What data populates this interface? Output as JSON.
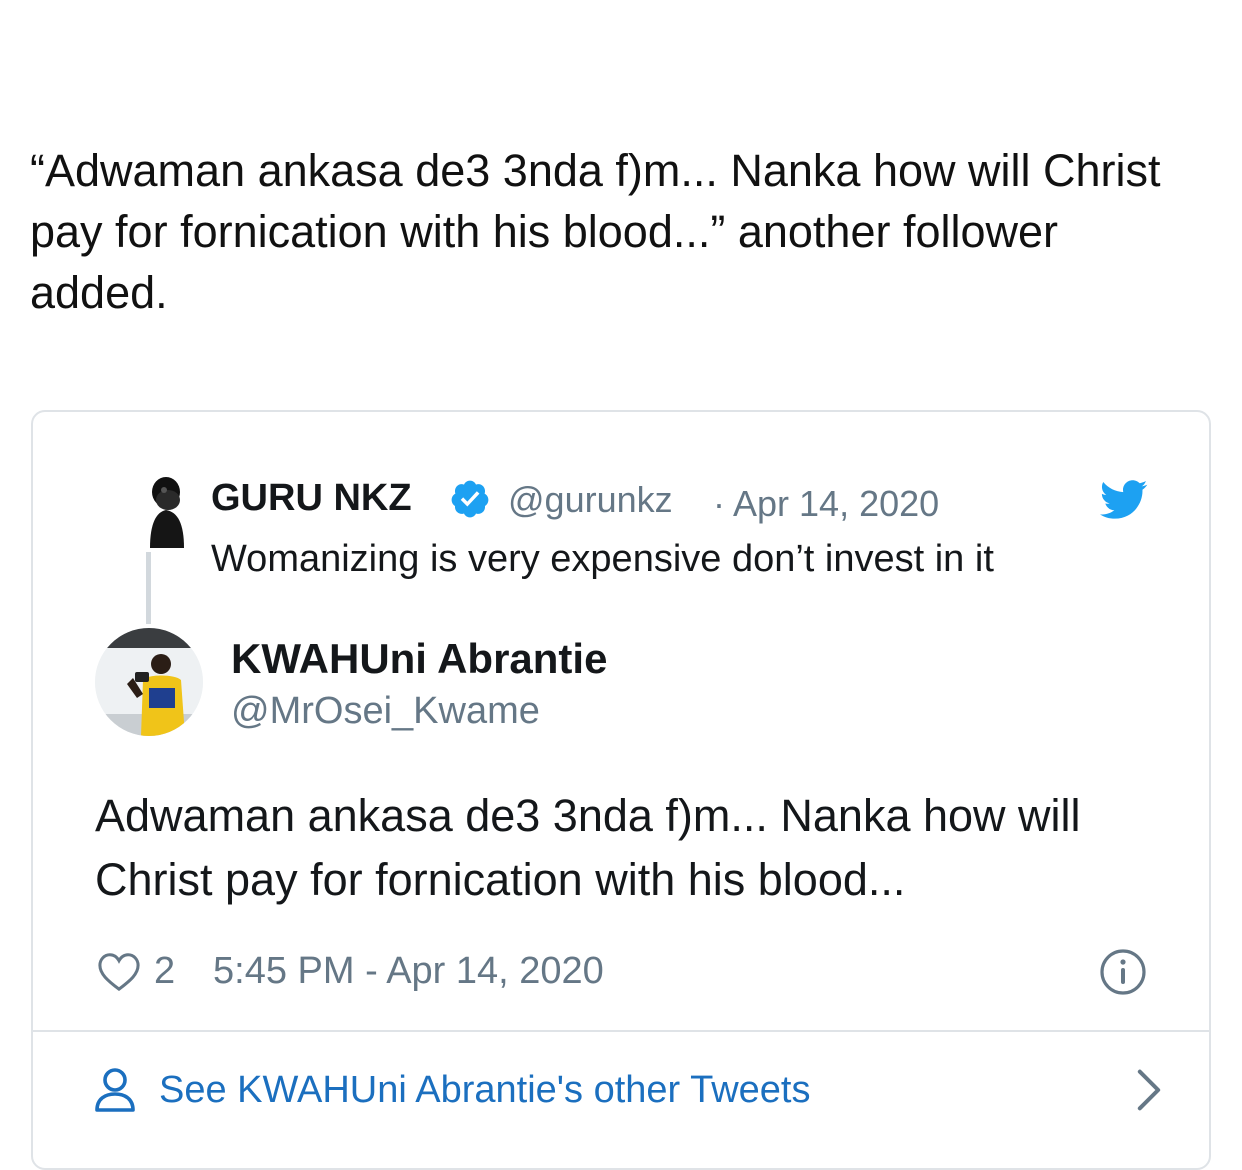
{
  "article": {
    "paragraph": "“Adwaman ankasa de3 3nda f)m... Nanka how will Christ pay for fornication with his blood...” another follower added."
  },
  "embedded_tweet": {
    "parent": {
      "name": "GURU NKZ",
      "handle": "@gurunkz",
      "date": "· Apr 14, 2020",
      "text": "Womanizing is very expensive don’t invest in it"
    },
    "author": {
      "name": "KWAHUni Abrantie",
      "handle": "@MrOsei_Kwame"
    },
    "text": "Adwaman ankasa de3 3nda f)m... Nanka how will Christ pay for fornication with his blood...",
    "likes": "2",
    "timestamp": "5:45 PM - Apr 14, 2020",
    "see_more_label": "See KWAHUni Abrantie's other Tweets"
  },
  "icons": {
    "verified": "verified-badge-icon",
    "bird": "twitter-bird-icon",
    "like": "heart-icon",
    "info": "info-icon",
    "profile": "person-icon",
    "more": "chevron-right-icon"
  },
  "colors": {
    "brand_blue": "#1da1f2",
    "link_blue": "#1b6fbf",
    "muted_text": "#657786",
    "border": "#dfe3e7"
  }
}
